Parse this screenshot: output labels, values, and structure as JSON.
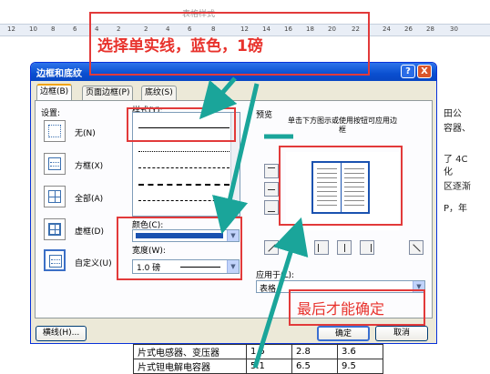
{
  "top_caption": "表格样式",
  "ruler": {
    "ticks": [
      "12",
      "10",
      "8",
      "6",
      "4",
      "2",
      "2",
      "4",
      "6",
      "8",
      "12",
      "14",
      "16",
      "18",
      "20",
      "22",
      "24",
      "26",
      "28",
      "30"
    ]
  },
  "background_text": [
    "田公",
    "容器、",
    "了 4C",
    "化",
    "区逐渐",
    "P，年"
  ],
  "annotations": {
    "top": "选择单实线，蓝色，1磅",
    "bottom": "最后才能确定"
  },
  "dialog": {
    "title": "边框和底纹",
    "help_label": "?",
    "close_label": "X",
    "tabs": [
      "边框(B)",
      "页面边框(P)",
      "底纹(S)"
    ],
    "settings_label": "设置:",
    "settings": [
      "无(N)",
      "方框(X)",
      "全部(A)",
      "虚框(D)",
      "自定义(U)"
    ],
    "style_label": "样式(Y):",
    "color_label": "颜色(C):",
    "color_value": "#1a52b0",
    "width_label": "宽度(W):",
    "width_value": "1.0 磅",
    "preview_label": "预览",
    "preview_hint": "单击下方图示或使用按钮可应用边框",
    "apply_to_label": "应用于(L):",
    "apply_to_value": "表格",
    "toolbar_button": "横线(H)...",
    "ok_button": "确定",
    "cancel_button": "取消"
  },
  "doc_table": [
    [
      "片式电感器、变压器",
      "1.5",
      "2.8",
      "3.6"
    ],
    [
      "片式钽电解电容器",
      "5.1",
      "6.5",
      "9.5"
    ]
  ]
}
